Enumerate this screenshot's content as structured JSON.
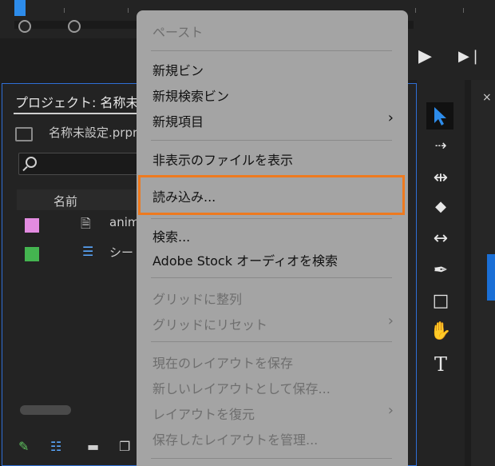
{
  "colors": {
    "accent": "#2f6fd6",
    "highlight": "#ee7a1f",
    "menu_bg": "#a4a4a4",
    "swatch_1": "#e28be0",
    "swatch_2": "#44b550"
  },
  "project": {
    "title": "プロジェクト: 名称未",
    "file_name": "名称未設定.prpr",
    "column_name": "名前",
    "rows": [
      {
        "label": "anima",
        "icon": "document-hand-icon"
      },
      {
        "label": "シー",
        "icon": "sequence-icon"
      }
    ]
  },
  "transport": {
    "play_icon": "▶",
    "step_icon": "▶❘"
  },
  "tools": [
    "selection-tool",
    "track-select-tool",
    "ripple-edit-tool",
    "razor-tool",
    "slip-tool",
    "pen-tool",
    "rectangle-tool",
    "hand-tool",
    "type-tool"
  ],
  "tool_glyphs": {
    "type": "T",
    "hand": "✋",
    "pen": "✒"
  },
  "right_panel": {
    "close": "×"
  },
  "menu": {
    "paste": "ペースト",
    "new_bin": "新規ビン",
    "new_search_bin": "新規検索ビン",
    "new_item": "新規項目",
    "show_hidden": "非表示のファイルを表示",
    "import": "読み込み...",
    "find": "検索...",
    "adobe_stock": "Adobe Stock オーディオを検索",
    "align_grid": "グリッドに整列",
    "reset_grid": "グリッドにリセット",
    "save_layout": "現在のレイアウトを保存",
    "save_new_layout": "新しいレイアウトとして保存...",
    "restore_layout": "レイアウトを復元",
    "manage_layouts": "保存したレイアウトを管理..."
  }
}
